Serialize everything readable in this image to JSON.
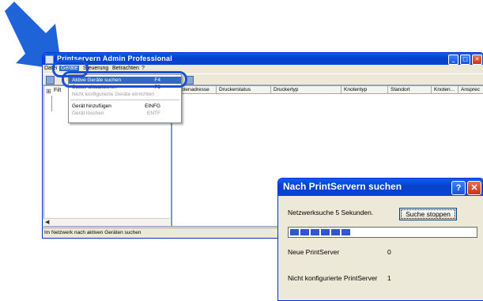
{
  "main_window": {
    "title": "Printservern Admin Professional",
    "menu": [
      "Datei",
      "Geräte",
      "Steuerung",
      "Betrachten",
      "?"
    ],
    "active_menu_index": 1,
    "tree_root_label": "Filt",
    "columns": [
      "Knotenadresse",
      "Druckerstatus",
      "Druckertyp",
      "Knotentyp",
      "Standort",
      "Knoten...",
      "Ansprec"
    ],
    "status": "Im Netzwerk nach aktiven Geräten suchen"
  },
  "menu_devices": {
    "items": [
      {
        "label": "Aktive Geräte suchen",
        "shortcut": "F4",
        "state": "selected"
      },
      {
        "label": "Status aktualisieren",
        "shortcut": "F5",
        "state": "enabled"
      },
      {
        "label": "Nicht konfigurierte Geräte einrichten",
        "shortcut": "",
        "state": "disabled"
      },
      {
        "label": "Gerät hinzufügen",
        "shortcut": "EINFG",
        "state": "enabled"
      },
      {
        "label": "Gerät löschen",
        "shortcut": "ENTF",
        "state": "disabled"
      }
    ]
  },
  "dialog": {
    "title": "Nach PrintServern suchen",
    "message": "Netzwerksuche 5 Sekunden.",
    "stop_button": "Suche stoppen",
    "progress": 0.35,
    "new_label": "Neue PrintServer",
    "new_value": "0",
    "unconfigured_label": "Nicht konfigurierte PrintServer",
    "unconfigured_value": "1"
  },
  "colors": {
    "titlebar": "#0a5ef0",
    "highlight": "#1a4fd8",
    "selection": "#316ac5",
    "progress": "#2f55d4"
  }
}
